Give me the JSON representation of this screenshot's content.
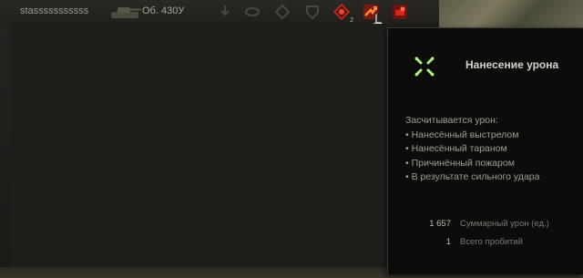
{
  "player": {
    "name": "stasssssssssss"
  },
  "vehicle": {
    "name": "Об. 430У"
  },
  "achievements": [
    {
      "icon": "armor-blocked-icon",
      "active": false
    },
    {
      "icon": "spotting-icon",
      "active": false
    },
    {
      "icon": "assist-icon",
      "active": false
    },
    {
      "icon": "crits-icon",
      "active": false
    },
    {
      "icon": "radio-damage-icon",
      "active": true,
      "badge": "2"
    },
    {
      "icon": "damage-dealt-icon",
      "active": true
    },
    {
      "icon": "module-damage-icon",
      "active": true
    }
  ],
  "tooltip": {
    "icon": "damage-crosshair-icon",
    "title": "Нанесение урона",
    "intro": "Засчитывается урон:",
    "items": [
      "• Нанесённый выстрелом",
      "• Нанесённый тараном",
      "• Причинённый пожаром",
      "• В результате сильного удара"
    ],
    "stats": [
      {
        "value": "1 657",
        "label": "Суммарный урон (ед.)"
      },
      {
        "value": "1",
        "label": "Всего пробитий"
      }
    ]
  },
  "colors": {
    "accent_red": "#d8281c",
    "icon_green": "#a8f07a"
  }
}
